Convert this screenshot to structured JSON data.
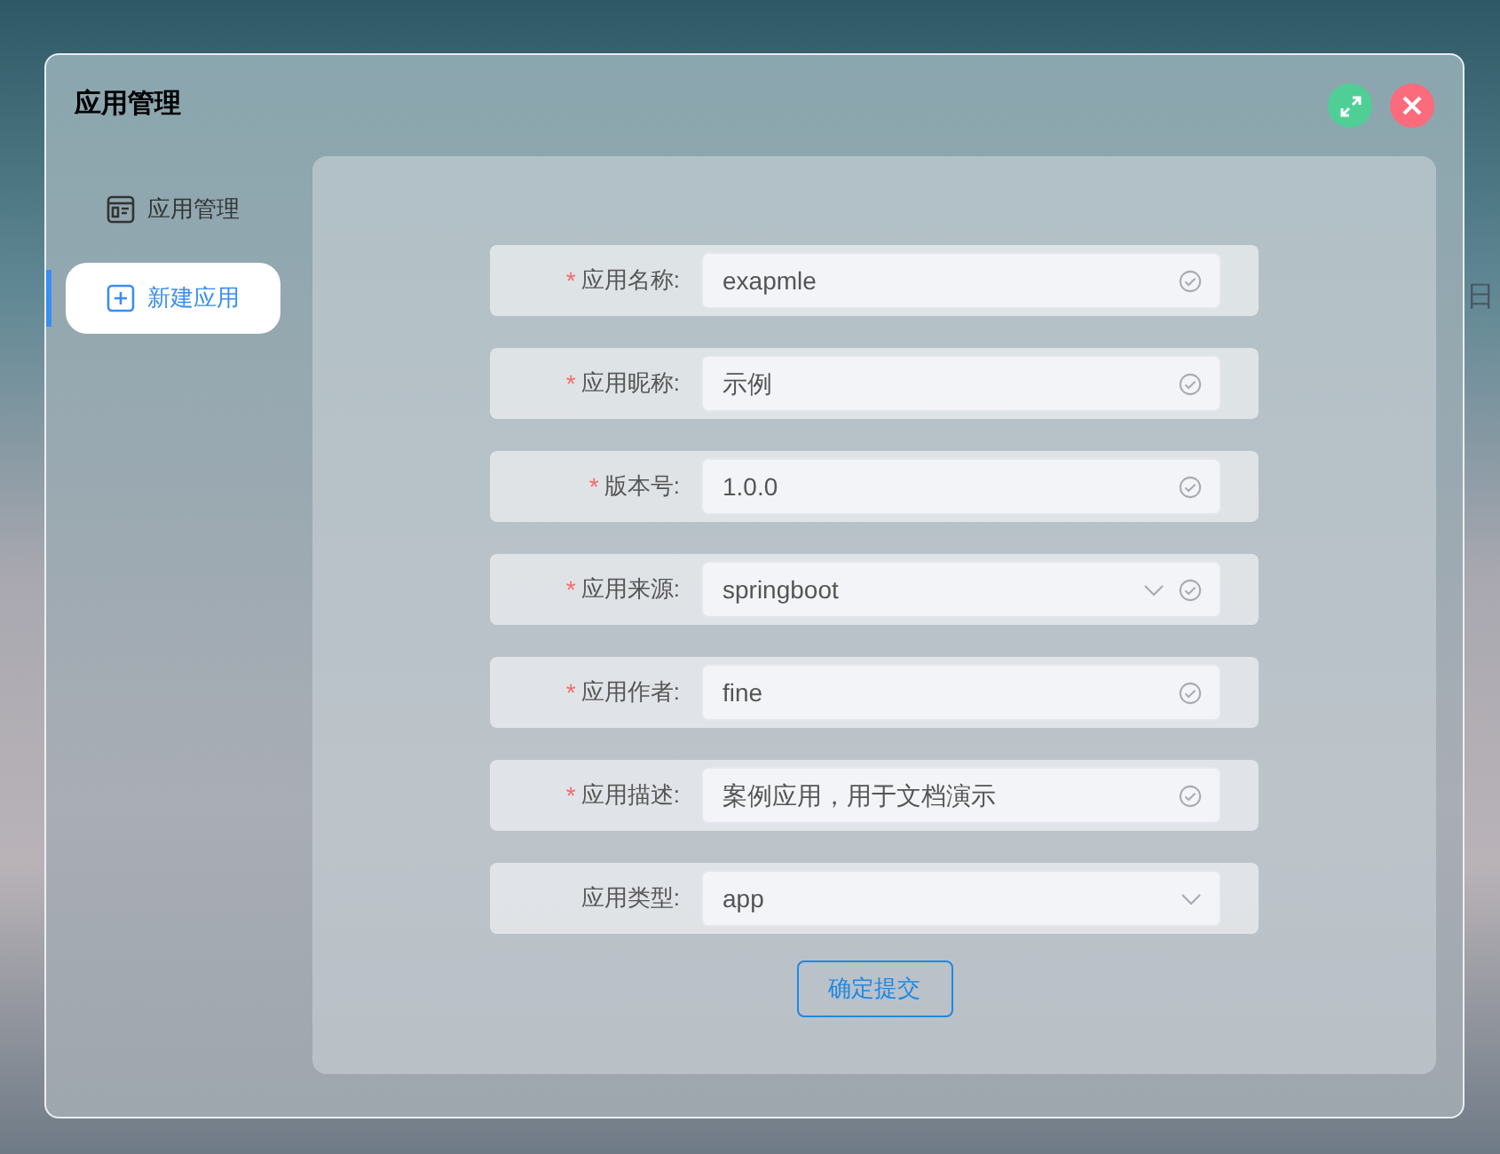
{
  "background_text": "日",
  "window": {
    "title": "应用管理"
  },
  "sidebar": {
    "items": [
      {
        "label": "应用管理",
        "selected": false
      },
      {
        "label": "新建应用",
        "selected": true
      }
    ]
  },
  "form": {
    "fields": [
      {
        "label": "应用名称:",
        "kind": "input",
        "required_mark": "*",
        "valid": true,
        "value": "exapmle"
      },
      {
        "label": "应用昵称:",
        "kind": "input",
        "required_mark": "*",
        "valid": true,
        "value": "示例"
      },
      {
        "label": "版本号:",
        "kind": "input",
        "required_mark": "*",
        "valid": true,
        "value": "1.0.0"
      },
      {
        "label": "应用来源:",
        "kind": "select",
        "required_mark": "*",
        "valid": true,
        "value": "springboot"
      },
      {
        "label": "应用作者:",
        "kind": "input",
        "required_mark": "*",
        "valid": true,
        "value": "fine"
      },
      {
        "label": "应用描述:",
        "kind": "input",
        "required_mark": "*",
        "valid": true,
        "value": "案例应用，用于文档演示"
      },
      {
        "label": "应用类型:",
        "kind": "select",
        "valid": false,
        "value": "app"
      }
    ],
    "submit": "确定提交"
  }
}
